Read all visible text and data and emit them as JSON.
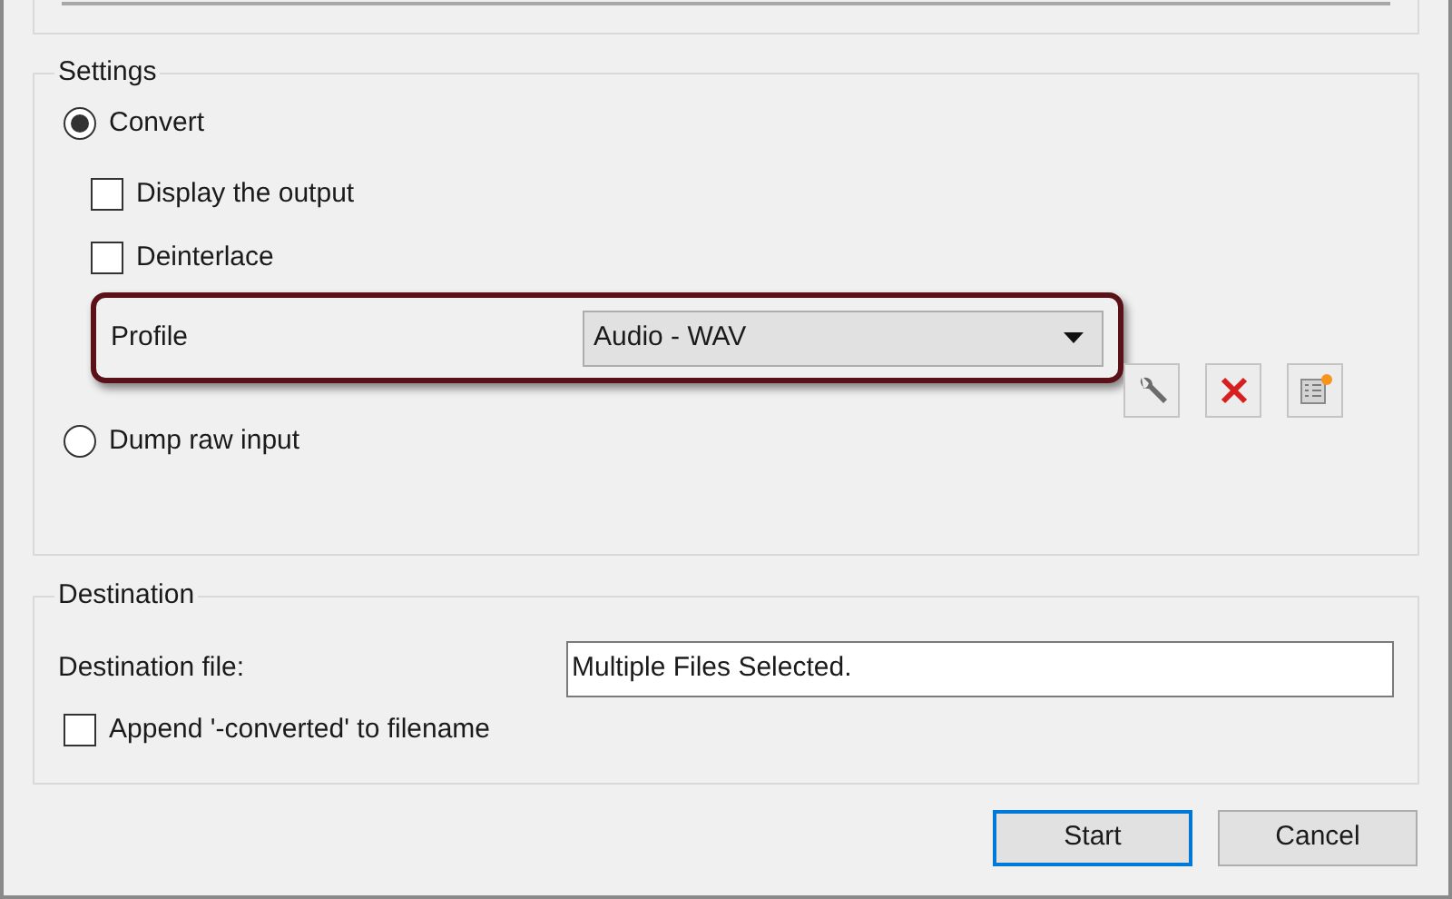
{
  "settings": {
    "title": "Settings",
    "convert": {
      "label": "Convert",
      "selected": true
    },
    "checkboxes": [
      {
        "label": "Display the output",
        "checked": false
      },
      {
        "label": "Deinterlace",
        "checked": false
      }
    ],
    "profile": {
      "label": "Profile",
      "value": "Audio - WAV"
    },
    "dump_raw": {
      "label": "Dump raw input",
      "selected": false
    }
  },
  "destination": {
    "title": "Destination",
    "file_label": "Destination file:",
    "file_value": "Multiple Files Selected.",
    "append": {
      "label": "Append '-converted' to filename",
      "checked": false
    }
  },
  "buttons": [
    {
      "label": "Start",
      "default": true
    },
    {
      "label": "Cancel",
      "default": false
    }
  ]
}
